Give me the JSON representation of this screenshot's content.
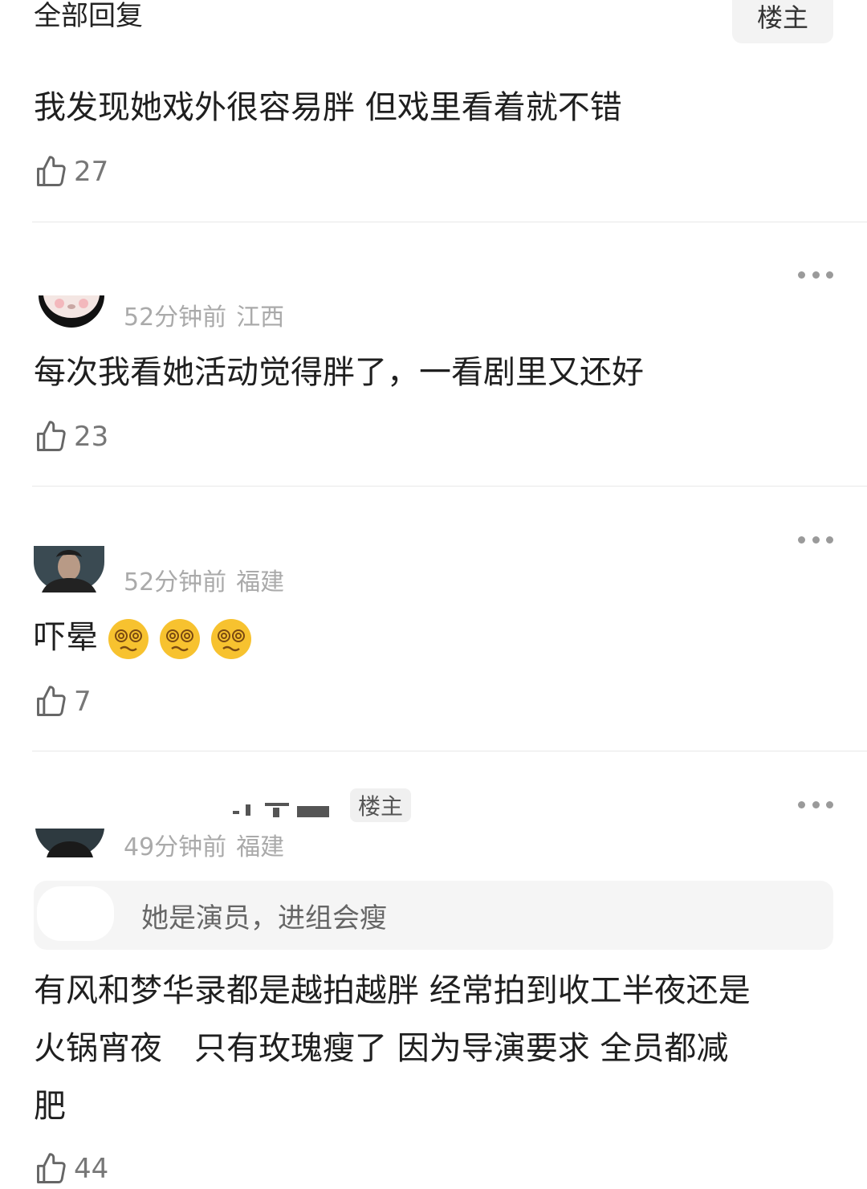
{
  "header": {
    "title": "全部回复",
    "op_filter_label": "楼主"
  },
  "comments": [
    {
      "text": "我发现她戏外很容易胖 但戏里看着就不错",
      "likes": "27"
    },
    {
      "time": "52分钟前",
      "location": "江西",
      "text": "每次我看她活动觉得胖了，一看剧里又还好",
      "likes": "23"
    },
    {
      "time": "52分钟前",
      "location": "福建",
      "text": "吓晕",
      "emojis": [
        "dizzy-face",
        "dizzy-face",
        "dizzy-face"
      ],
      "likes": "7"
    },
    {
      "badge": "楼主",
      "time": "49分钟前",
      "location": "福建",
      "quote": "她是演员，进组会瘦",
      "text_lines": [
        "有风和梦华录都是越拍越胖 经常拍到收工半夜还是",
        "火锅宵夜　只有玫瑰瘦了 因为导演要求 全员都减",
        "肥"
      ],
      "likes": "44"
    }
  ],
  "icons": {
    "like": "thumbs-up-icon",
    "more": "more-dots-icon"
  },
  "colors": {
    "text": "#1f1f1f",
    "meta": "#aaaaaa",
    "icon": "#666666",
    "divider": "#e8e8e8"
  }
}
